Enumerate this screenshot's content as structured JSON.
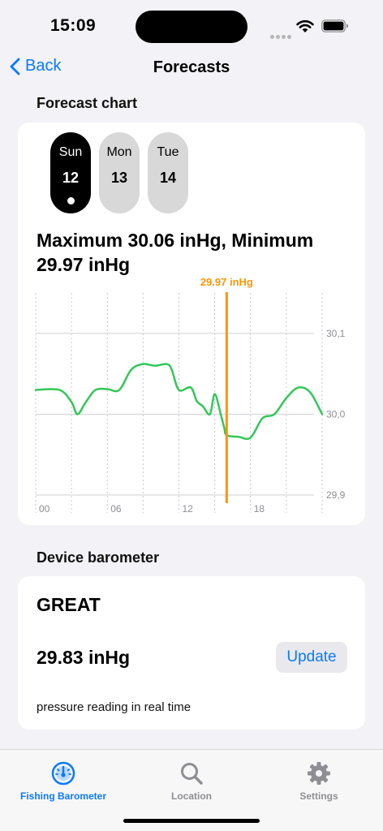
{
  "status_bar": {
    "time": "15:09"
  },
  "nav": {
    "back_label": "Back",
    "title": "Forecasts"
  },
  "forecast_section": {
    "header": "Forecast chart",
    "days": [
      {
        "name": "Sun",
        "number": "12",
        "selected": true
      },
      {
        "name": "Mon",
        "number": "13",
        "selected": false
      },
      {
        "name": "Tue",
        "number": "14",
        "selected": false
      }
    ],
    "summary": "Maximum 30.06 inHg, Minimum 29.97 inHg"
  },
  "chart_data": {
    "type": "line",
    "series": [
      {
        "color": "#34c759",
        "points": [
          [
            0,
            30.03
          ],
          [
            2,
            30.03
          ],
          [
            3,
            30.015
          ],
          [
            3.5,
            30.0
          ],
          [
            4.2,
            30.015
          ],
          [
            5,
            30.03
          ],
          [
            6,
            30.031
          ],
          [
            7,
            30.03
          ],
          [
            8,
            30.055
          ],
          [
            9,
            30.062
          ],
          [
            10,
            30.06
          ],
          [
            11,
            30.062
          ],
          [
            11.4,
            30.055
          ],
          [
            12,
            30.03
          ],
          [
            13,
            30.033
          ],
          [
            13.5,
            30.016
          ],
          [
            14,
            30.01
          ],
          [
            14.6,
            30.0
          ],
          [
            15,
            30.025
          ],
          [
            15.5,
            30.0
          ],
          [
            15.8,
            29.983
          ],
          [
            16,
            29.974
          ],
          [
            17,
            29.972
          ],
          [
            18,
            29.971
          ],
          [
            19,
            29.995
          ],
          [
            20,
            30.0
          ],
          [
            21,
            30.02
          ],
          [
            22,
            30.033
          ],
          [
            23,
            30.027
          ],
          [
            24,
            30.0
          ]
        ]
      }
    ],
    "x_ticks": [
      "00",
      "06",
      "12",
      "18"
    ],
    "y_ticks": [
      "30,1",
      "30,0",
      "29,9"
    ],
    "xlim": [
      0,
      24
    ],
    "ylim": [
      29.89,
      30.15
    ],
    "grid": true,
    "selected_x": 16,
    "selected_label": "29.97 inHg",
    "selected_color": "#ff9500"
  },
  "device_section": {
    "header": "Device barometer",
    "status": "GREAT",
    "pressure": "29.83 inHg",
    "update_label": "Update",
    "caption": "pressure reading in real time"
  },
  "tab_bar": {
    "tabs": [
      {
        "label": "Fishing Barometer",
        "icon": "gauge-icon",
        "active": true
      },
      {
        "label": "Location",
        "icon": "search-icon",
        "active": false
      },
      {
        "label": "Settings",
        "icon": "gear-icon",
        "active": false
      }
    ],
    "active_color": "#0a7aff",
    "inactive_color": "#8e8e93"
  }
}
